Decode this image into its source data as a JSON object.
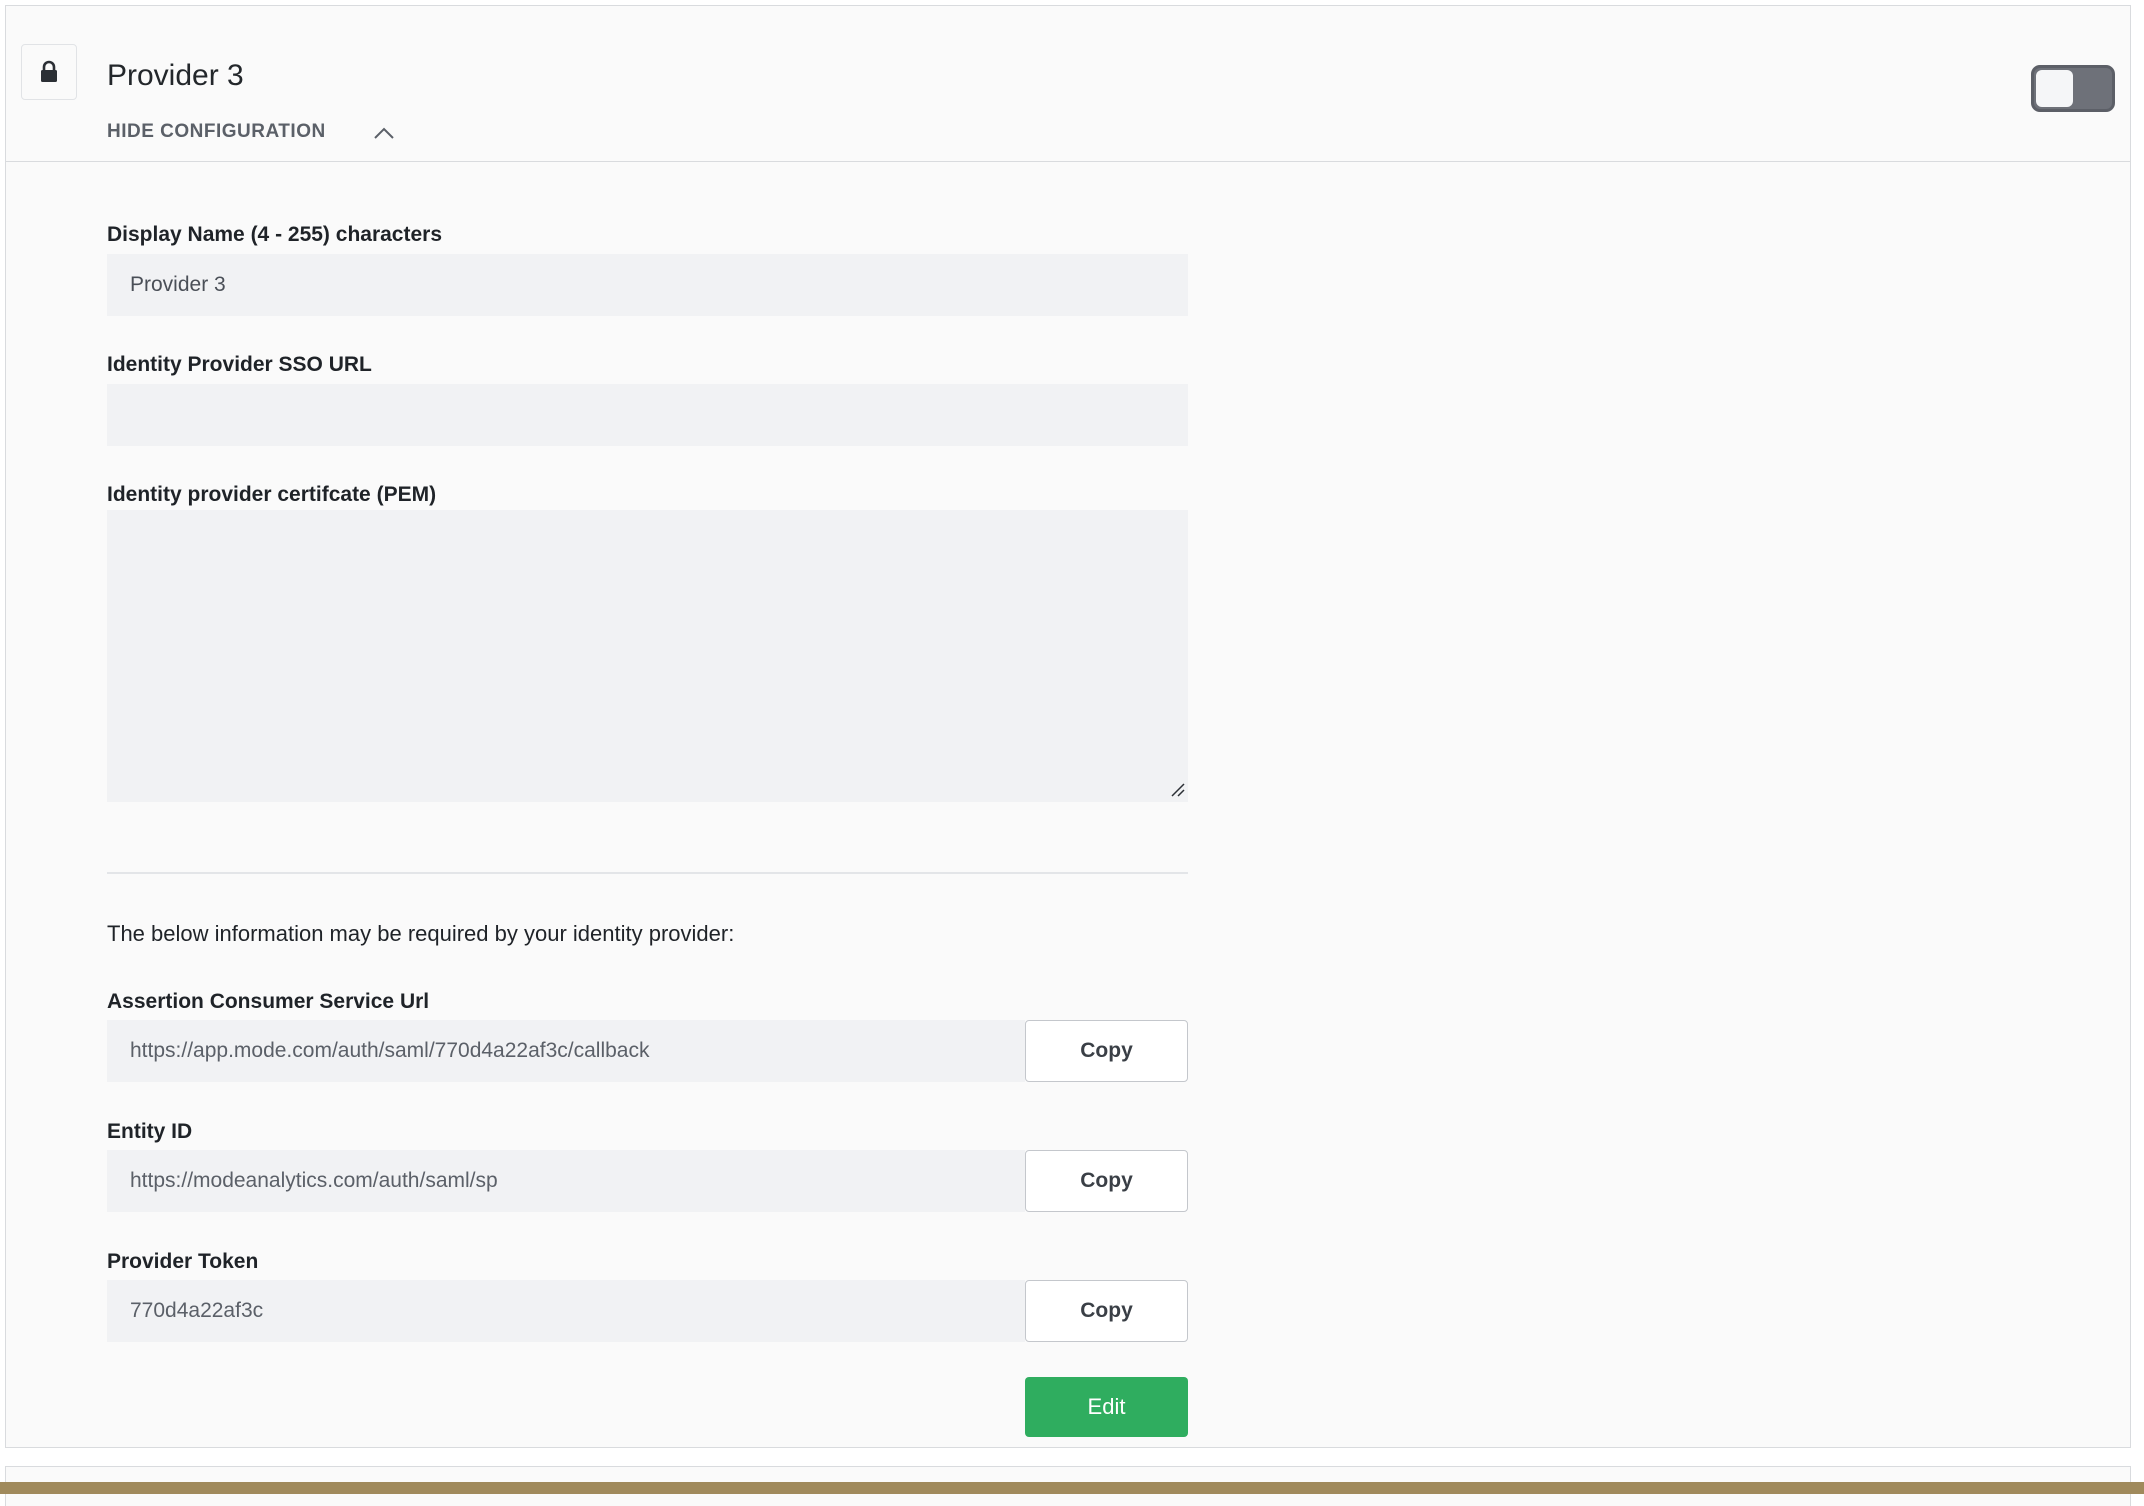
{
  "header": {
    "title": "Provider 3",
    "hide_config_label": "HIDE CONFIGURATION",
    "toggle_state": "off"
  },
  "form": {
    "display_name_label": "Display Name (4 - 255) characters",
    "display_name_value": "Provider 3",
    "sso_url_label": "Identity Provider SSO URL",
    "sso_url_value": "",
    "certificate_label": "Identity provider certifcate (PEM)",
    "certificate_value": ""
  },
  "info": {
    "text": "The below information may be required by your identity provider:",
    "acs_label": "Assertion Consumer Service Url",
    "acs_value": "https://app.mode.com/auth/saml/770d4a22af3c/callback",
    "entity_label": "Entity ID",
    "entity_value": "https://modeanalytics.com/auth/saml/sp",
    "token_label": "Provider Token",
    "token_value": "770d4a22af3c",
    "copy_label": "Copy"
  },
  "actions": {
    "edit_label": "Edit"
  },
  "colors": {
    "primary_green": "#2fad5f",
    "toggle_off": "#6e7179",
    "bottom_bar": "#a08a5c"
  }
}
